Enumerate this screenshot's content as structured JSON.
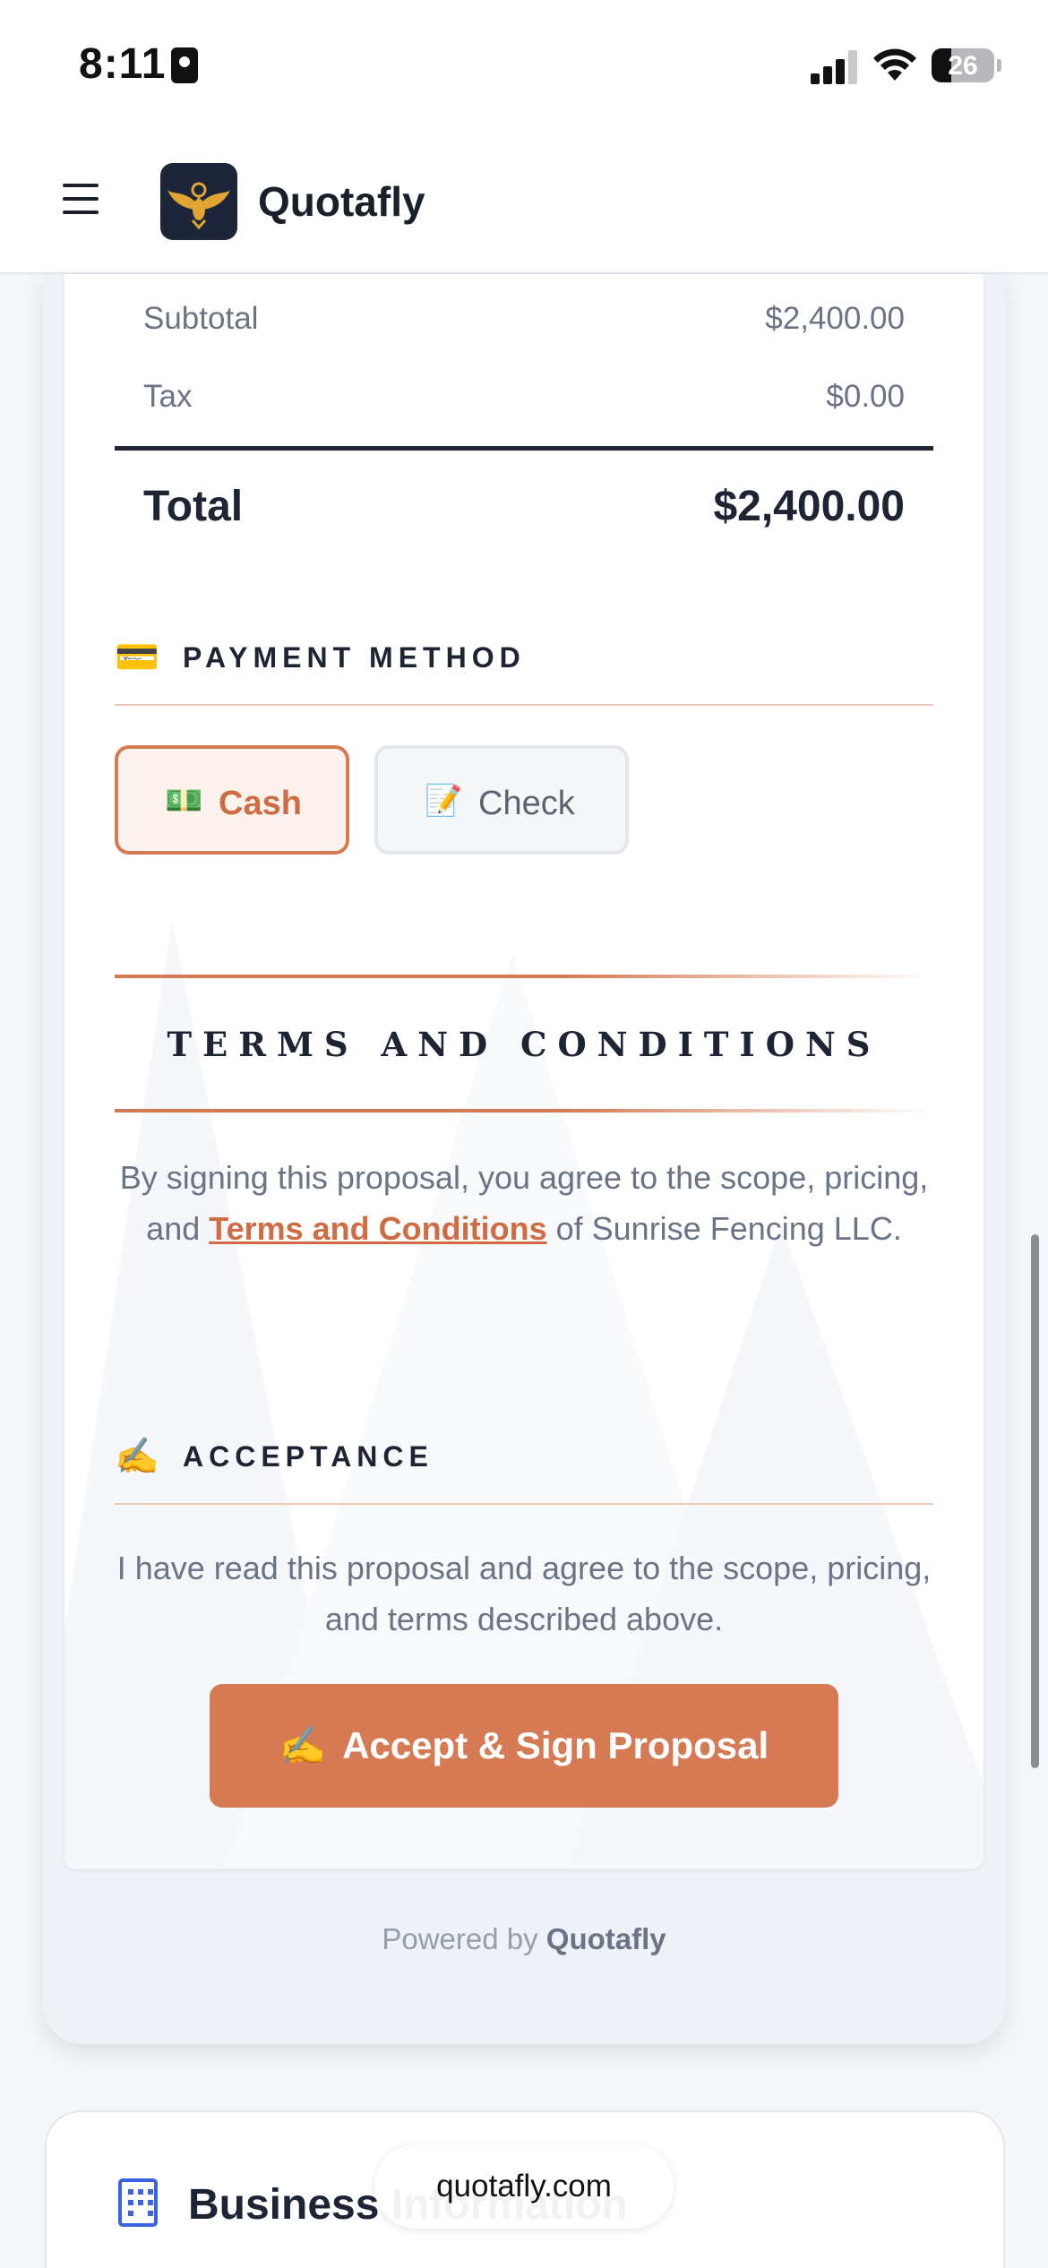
{
  "status_bar": {
    "time": "8:11",
    "battery": "26"
  },
  "header": {
    "brand": "Quotafly"
  },
  "summary": {
    "subtotal_label": "Subtotal",
    "subtotal_value": "$2,400.00",
    "tax_label": "Tax",
    "tax_value": "$0.00",
    "total_label": "Total",
    "total_value": "$2,400.00"
  },
  "payment": {
    "title": "PAYMENT METHOD",
    "title_icon": "💳",
    "options": [
      {
        "label": "Cash",
        "icon": "💵",
        "selected": true
      },
      {
        "label": "Check",
        "icon": "📝",
        "selected": false
      }
    ]
  },
  "terms": {
    "title": "TERMS AND CONDITIONS",
    "text_before": "By signing this proposal, you agree to the scope, pricing, and ",
    "link": "Terms and Conditions",
    "text_after": " of Sunrise Fencing LLC."
  },
  "acceptance": {
    "title": "ACCEPTANCE",
    "title_icon": "✍️",
    "text": "I have read this proposal and agree to the scope, pricing, and terms described above.",
    "button_icon": "✍️",
    "button_label": "Accept & Sign Proposal"
  },
  "footer": {
    "powered_prefix": "Powered by",
    "powered_brand": "Quotafly"
  },
  "business": {
    "title": "Business Information"
  },
  "browser": {
    "url": "quotafly.com"
  },
  "colors": {
    "accent": "#d67a53",
    "dark": "#1e2433",
    "muted": "#6b7384",
    "icon_blue": "#3b63e0"
  }
}
